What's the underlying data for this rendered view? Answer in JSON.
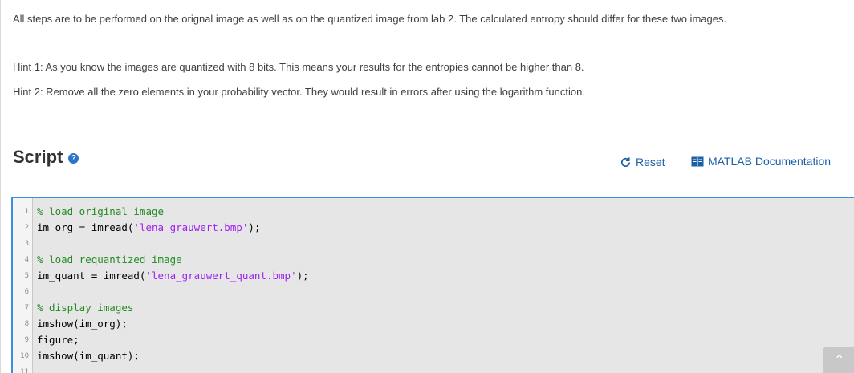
{
  "instructions": {
    "p1": "All steps are to be performed on the orignal image as well as on the quantized image from lab 2. The calculated entropy should differ for these two images.",
    "p2": "Hint 1: As you know the images are quantized with 8 bits. This means your results for the entropies cannot be higher than 8.",
    "p3": "Hint 2: Remove all the zero elements in your probability vector. They would result in errors after using the logarithm function."
  },
  "script": {
    "title": "Script",
    "help_icon": "question-circle-icon",
    "reset_label": "Reset",
    "doc_label": "MATLAB Documentation"
  },
  "editor": {
    "lines": [
      {
        "n": "1",
        "parts": [
          {
            "t": "% load original image",
            "c": "comment"
          }
        ]
      },
      {
        "n": "2",
        "parts": [
          {
            "t": "im_org = imread(",
            "c": "plain"
          },
          {
            "t": "'lena_grauwert.bmp'",
            "c": "string"
          },
          {
            "t": ");",
            "c": "plain"
          }
        ]
      },
      {
        "n": "3",
        "parts": []
      },
      {
        "n": "4",
        "parts": [
          {
            "t": "% load requantized image",
            "c": "comment"
          }
        ]
      },
      {
        "n": "5",
        "parts": [
          {
            "t": "im_quant = imread(",
            "c": "plain"
          },
          {
            "t": "'lena_grauwert_quant.bmp'",
            "c": "string"
          },
          {
            "t": ");",
            "c": "plain"
          }
        ]
      },
      {
        "n": "6",
        "parts": []
      },
      {
        "n": "7",
        "parts": [
          {
            "t": "% display images",
            "c": "comment"
          }
        ]
      },
      {
        "n": "8",
        "parts": [
          {
            "t": "imshow(im_org);",
            "c": "plain"
          }
        ]
      },
      {
        "n": "9",
        "parts": [
          {
            "t": "figure;",
            "c": "plain"
          }
        ]
      },
      {
        "n": "10",
        "parts": [
          {
            "t": "imshow(im_quant);",
            "c": "plain"
          }
        ]
      },
      {
        "n": "11",
        "parts": []
      }
    ]
  },
  "colors": {
    "link": "#1a5fa8",
    "comment": "#228b22",
    "string": "#a020f0",
    "editor_border": "#3d8fe0"
  }
}
